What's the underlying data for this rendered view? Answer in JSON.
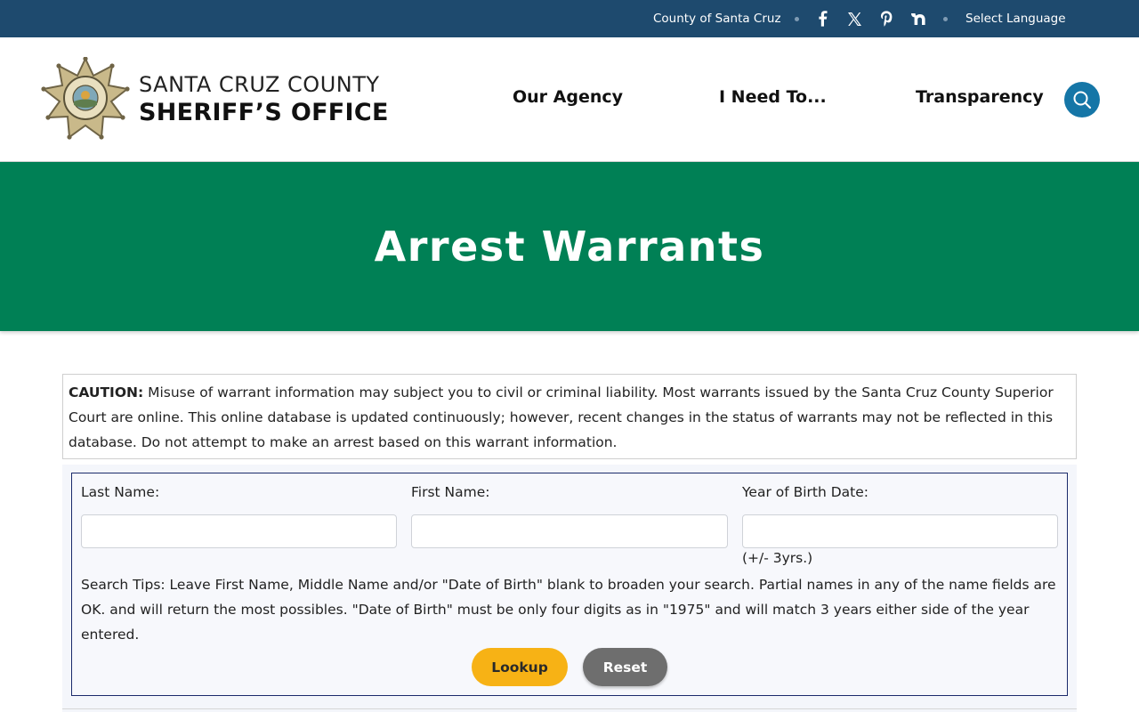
{
  "topbar": {
    "county_link": "County of Santa Cruz",
    "social": [
      {
        "name": "facebook-icon"
      },
      {
        "name": "x-twitter-icon"
      },
      {
        "name": "pinterest-icon"
      },
      {
        "name": "nextdoor-icon"
      }
    ],
    "language_label": "Select Language"
  },
  "header": {
    "brand_line1": "SANTA CRUZ COUNTY",
    "brand_line2": "SHERIFF’S OFFICE",
    "nav": {
      "our_agency": "Our Agency",
      "i_need_to": "I Need To...",
      "transparency": "Transparency"
    }
  },
  "banner": {
    "title": "Arrest Warrants"
  },
  "caution": {
    "label": "CAUTION:",
    "text": " Misuse of warrant information may subject you to civil or criminal liability. Most warrants issued by the Santa Cruz County Superior Court are online. This online database is updated continuously; however, recent changes in the status of warrants may not be reflected in this database. Do not attempt to make an arrest based on this warrant information."
  },
  "form": {
    "last_name_label": "Last Name:",
    "first_name_label": "First Name:",
    "year_of_birth_label": "Year of Birth Date:",
    "last_name_value": "",
    "first_name_value": "",
    "year_of_birth_value": "",
    "year_hint": "(+/- 3yrs.)",
    "tips": "Search Tips: Leave First Name, Middle Name and/or \"Date of Birth\" blank to broaden your search. Partial names in any of the name fields are OK. and will return the most possibles. \"Date of Birth\" must be only four digits as in \"1975\" and will match 3 years either side of the year entered.",
    "lookup_label": "Lookup",
    "reset_label": "Reset"
  },
  "colors": {
    "topbar": "#1e4a6e",
    "banner": "#008055",
    "search_button": "#1576a7",
    "lookup_button": "#f7b215",
    "reset_button": "#6e6e6e"
  }
}
